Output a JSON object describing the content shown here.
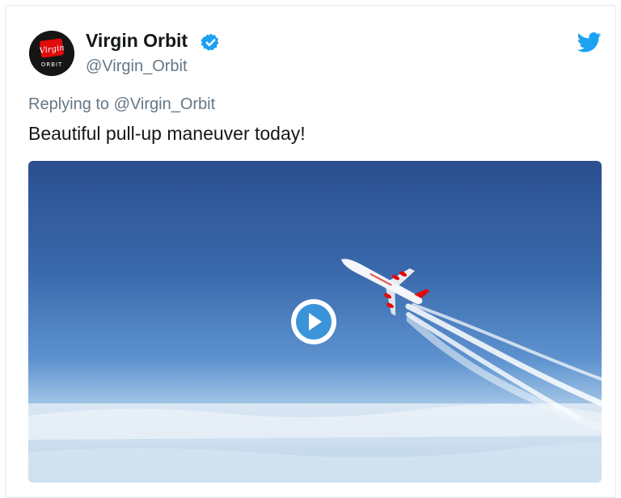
{
  "tweet": {
    "display_name": "Virgin Orbit",
    "handle": "@Virgin_Orbit",
    "reply_prefix": "Replying to",
    "reply_to": "@Virgin_Orbit",
    "text": "Beautiful pull-up maneuver today!"
  },
  "avatar": {
    "logo_script": "Virgin",
    "logo_text": "ORBIT"
  },
  "icons": {
    "verified": "verified-badge-icon",
    "twitter": "twitter-bird-icon",
    "play": "play-icon"
  },
  "colors": {
    "verified_blue": "#1da1f2",
    "play_blue": "#3b94d9",
    "name": "#14171a",
    "muted": "#657786",
    "brand_red": "#e10a0a"
  }
}
